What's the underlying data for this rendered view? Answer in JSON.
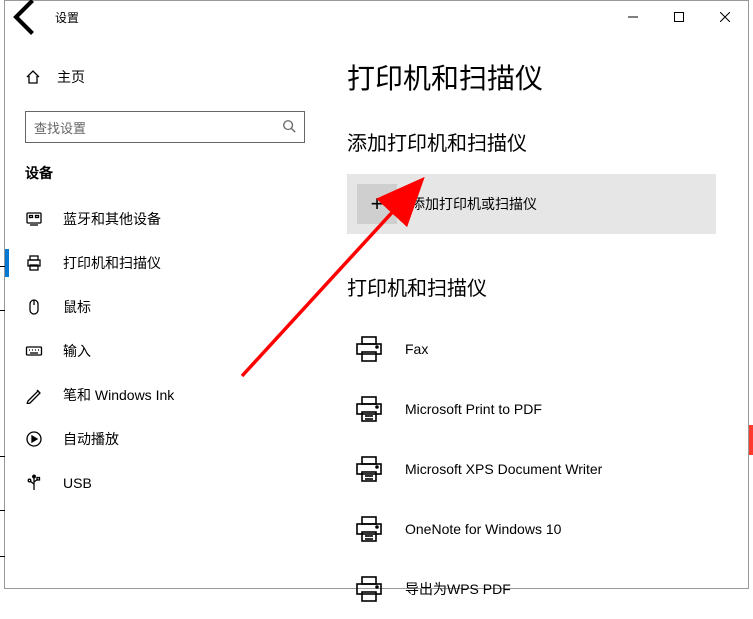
{
  "titlebar": {
    "app_name": "设置"
  },
  "sidebar": {
    "home_label": "主页",
    "search_placeholder": "查找设置",
    "category": "设备",
    "items": [
      {
        "id": "bluetooth",
        "label": "蓝牙和其他设备"
      },
      {
        "id": "printers",
        "label": "打印机和扫描仪"
      },
      {
        "id": "mouse",
        "label": "鼠标"
      },
      {
        "id": "typing",
        "label": "输入"
      },
      {
        "id": "pen",
        "label": "笔和 Windows Ink"
      },
      {
        "id": "autoplay",
        "label": "自动播放"
      },
      {
        "id": "usb",
        "label": "USB"
      }
    ],
    "selected": "printers"
  },
  "main": {
    "title": "打印机和扫描仪",
    "add_section": "添加打印机和扫描仪",
    "add_button": "添加打印机或扫描仪",
    "list_section": "打印机和扫描仪",
    "printers": [
      {
        "name": "Fax"
      },
      {
        "name": "Microsoft Print to PDF"
      },
      {
        "name": "Microsoft XPS Document Writer"
      },
      {
        "name": "OneNote for Windows 10"
      },
      {
        "name": "导出为WPS PDF"
      }
    ]
  }
}
